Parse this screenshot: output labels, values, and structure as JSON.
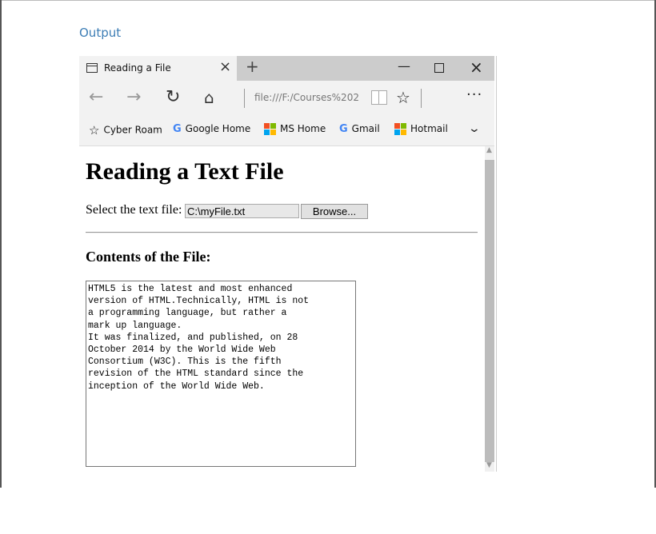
{
  "output_label": "Output",
  "browser": {
    "tab_title": "Reading a File",
    "tab_close": "×",
    "new_tab": "+",
    "window": {
      "minimize": "—",
      "close": "×"
    },
    "nav": {
      "back": "←",
      "forward": "→",
      "refresh": "↻",
      "home": "⌂",
      "address": "file:///F:/Courses%202",
      "favorite": "☆",
      "more": "···"
    },
    "favorites": [
      {
        "label": "Cyber Roam",
        "icon": "star-icon"
      },
      {
        "label": "Google Home",
        "icon": "google-icon"
      },
      {
        "label": "MS Home",
        "icon": "microsoft-icon"
      },
      {
        "label": "Gmail",
        "icon": "google-icon"
      },
      {
        "label": "Hotmail",
        "icon": "microsoft-icon"
      }
    ],
    "favorites_more": "⌄"
  },
  "page": {
    "title": "Reading a Text File",
    "select_label": "Select the text file:",
    "file_value": "C:\\myFile.txt",
    "browse_label": "Browse...",
    "contents_heading": "Contents of the File:",
    "file_contents": "HTML5 is the latest and most enhanced\nversion of HTML.Technically, HTML is not\na programming language, but rather a\nmark up language.\nIt was finalized, and published, on 28\nOctober 2014 by the World Wide Web\nConsortium (W3C). This is the fifth\nrevision of the HTML standard since the\ninception of the World Wide Web."
  }
}
